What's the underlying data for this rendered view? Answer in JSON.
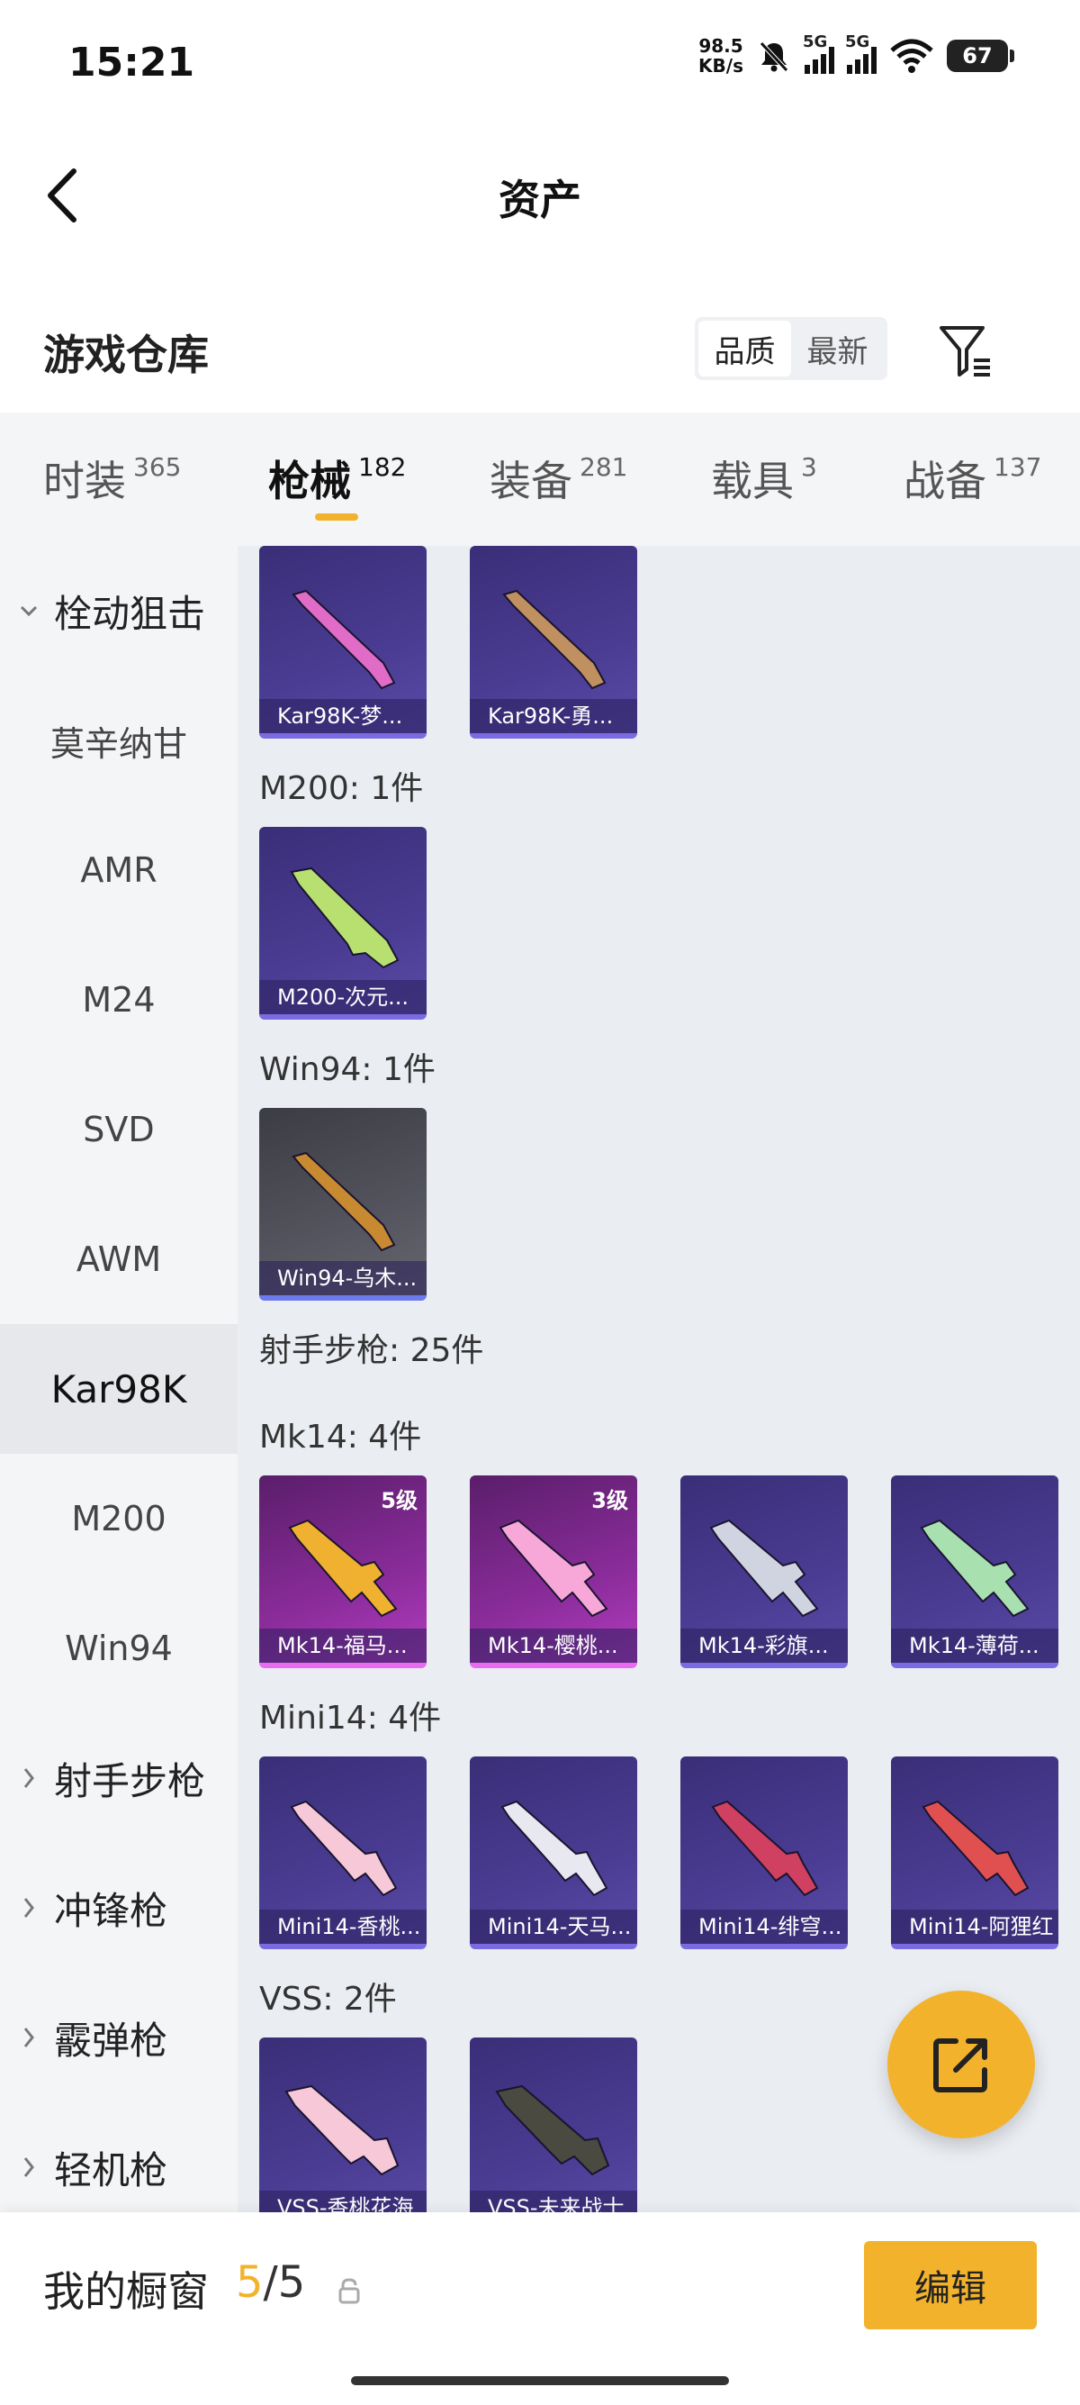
{
  "status_bar": {
    "time": "15:21",
    "net_speed_value": "98.5",
    "net_speed_unit": "KB/s",
    "signal1_label": "5G",
    "signal2_label": "5G",
    "battery": "67",
    "icons": [
      "mute-bell-icon",
      "signal-icon",
      "signal-icon",
      "wifi-icon",
      "battery-icon"
    ]
  },
  "header": {
    "title": "资产"
  },
  "warehouse": {
    "title": "游戏仓库",
    "sort_options": [
      "品质",
      "最新"
    ],
    "active_sort": "品质"
  },
  "category_tabs": [
    {
      "label": "时装",
      "count": "365"
    },
    {
      "label": "枪械",
      "count": "182",
      "active": true
    },
    {
      "label": "装备",
      "count": "281"
    },
    {
      "label": "载具",
      "count": "3"
    },
    {
      "label": "战备",
      "count": "137"
    }
  ],
  "sidebar": {
    "items": [
      {
        "label": "栓动狙击",
        "type": "group",
        "expanded": true
      },
      {
        "label": "莫辛纳甘"
      },
      {
        "label": "AMR"
      },
      {
        "label": "M24"
      },
      {
        "label": "SVD"
      },
      {
        "label": "AWM"
      },
      {
        "label": "Kar98K",
        "selected": true
      },
      {
        "label": "M200"
      },
      {
        "label": "Win94"
      },
      {
        "label": "射手步枪",
        "type": "group"
      },
      {
        "label": "冲锋枪",
        "type": "group"
      },
      {
        "label": "霰弹枪",
        "type": "group"
      },
      {
        "label": "轻机枪",
        "type": "group"
      }
    ]
  },
  "content": {
    "labels": {
      "m200": "M200: 1件",
      "win94": "Win94: 1件",
      "dmr": "射手步枪: 25件",
      "mk14": "Mk14: 4件",
      "mini14": "Mini14: 4件",
      "vss": "VSS: 2件"
    },
    "cards": {
      "kar1": {
        "name": "Kar98K-梦...",
        "color": "#e06cc8"
      },
      "kar2": {
        "name": "Kar98K-勇...",
        "color": "#c09060"
      },
      "m200": {
        "name": "M200-次元...",
        "color": "#b8e070"
      },
      "win94": {
        "name": "Win94-乌木...",
        "color": "#c88a30"
      },
      "mk14_1": {
        "name": "Mk14-福马...",
        "level": "5级",
        "color": "#f0b030"
      },
      "mk14_2": {
        "name": "Mk14-樱桃...",
        "level": "3级",
        "color": "#f7a8d8"
      },
      "mk14_3": {
        "name": "Mk14-彩旗...",
        "color": "#d0d4e0"
      },
      "mk14_4": {
        "name": "Mk14-薄荷...",
        "color": "#a8e0b0"
      },
      "mini1": {
        "name": "Mini14-香桃...",
        "color": "#f6c8d8"
      },
      "mini2": {
        "name": "Mini14-天马...",
        "color": "#e8e8f0"
      },
      "mini3": {
        "name": "Mini14-绯穹...",
        "color": "#d04060"
      },
      "mini4": {
        "name": "Mini14-阿狸红",
        "color": "#e05050"
      },
      "vss1": {
        "name": "VSS-香桃花海",
        "color": "#f6c8d8"
      },
      "vss2": {
        "name": "VSS-未来战士",
        "color": "#4a4a40"
      }
    }
  },
  "bottom_bar": {
    "label": "我的橱窗",
    "current": "5",
    "separator": "/",
    "max": "5",
    "edit_label": "编辑"
  }
}
